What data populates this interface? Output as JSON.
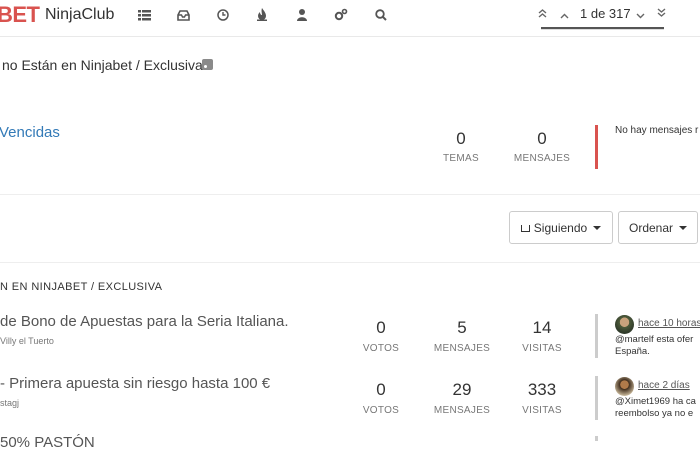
{
  "header": {
    "brand_mark": "BET",
    "brand_name": "NinjaClub",
    "nav_icons": [
      "list-icon",
      "inbox-icon",
      "clock-icon",
      "fire-icon",
      "user-icon",
      "cogs-icon",
      "search-icon"
    ],
    "pager": {
      "text": "1 de 317"
    }
  },
  "breadcrumb": {
    "text": "no Están en Ninjabet / Exclusiva"
  },
  "category": {
    "title": "Vencidas",
    "topics_count": "0",
    "topics_label": "TEMAS",
    "posts_count": "0",
    "posts_label": "MENSAJES",
    "no_posts_text": "No hay mensajes r",
    "accent_color": "#d9534f"
  },
  "toolbar": {
    "watch_label": "Siguiendo",
    "sort_label": "Ordenar"
  },
  "topics_section": {
    "heading": "N EN NINJABET / EXCLUSIVA"
  },
  "topics": [
    {
      "title": "de Bono de Apuestas para la Seria Italiana.",
      "author": "Villy el Tuerto",
      "votes": "0",
      "votes_label": "VOTOS",
      "posts": "5",
      "posts_label": "MENSAJES",
      "views": "14",
      "views_label": "VISITAS",
      "last_time": "hace 10 horas",
      "teaser_line1": "@martelf esta ofer",
      "teaser_line2": "España."
    },
    {
      "title": "- Primera apuesta sin riesgo hasta 100 €",
      "author": "stagj",
      "votes": "0",
      "votes_label": "VOTOS",
      "posts": "29",
      "posts_label": "MENSAJES",
      "views": "333",
      "views_label": "VISITAS",
      "last_time": "hace 2 días",
      "teaser_line1": "@Ximet1969 ha ca",
      "teaser_line2": "reembolso ya no e"
    },
    {
      "title": "50% PASTÓN"
    }
  ]
}
